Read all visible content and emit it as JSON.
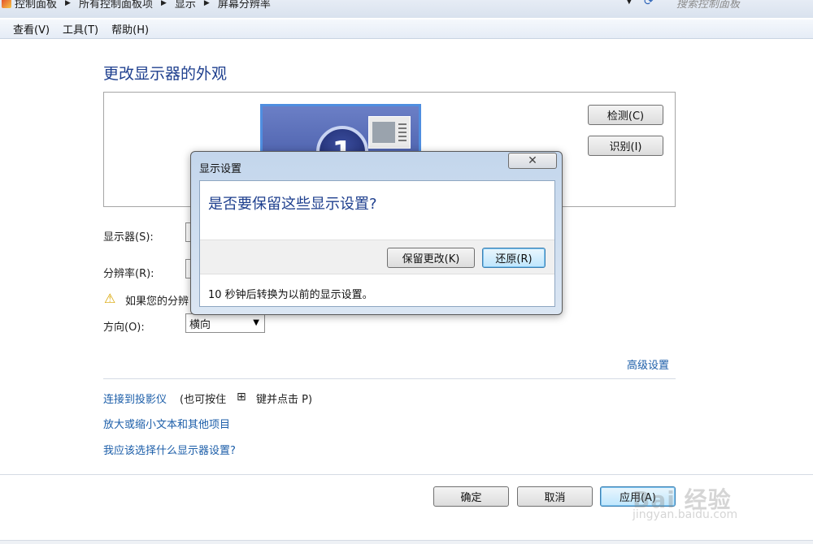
{
  "address_bar": {
    "crumbs": [
      "控制面板",
      "所有控制面板项",
      "显示",
      "屏幕分辨率"
    ],
    "search_placeholder": "搜索控制面板"
  },
  "menu": [
    "查看(V)",
    "工具(T)",
    "帮助(H)"
  ],
  "main": {
    "title": "更改显示器的外观",
    "monitor_number": "1",
    "detect_button": "检测(C)",
    "identify_button": "识别(I)",
    "display_label": "显示器(S):",
    "resolution_label": "分辨率(R):",
    "warning_text": "如果您的分辨",
    "orientation_label": "方向(O):",
    "orientation_value": "横向",
    "advanced_link": "高级设置",
    "projector_link": "连接到投影仪",
    "projector_hint_pre": "(也可按住",
    "projector_hint_post": "键并点击 P)",
    "text_size_link": "放大或缩小文本和其他项目",
    "which_settings_link": "我应该选择什么显示器设置?",
    "ok_button": "确定",
    "cancel_button": "取消",
    "apply_button": "应用(A)"
  },
  "dialog": {
    "title": "显示设置",
    "question": "是否要保留这些显示设置?",
    "keep_button": "保留更改(K)",
    "revert_button": "还原(R)",
    "countdown": "10 秒钟后转换为以前的显示设置。"
  },
  "watermark": {
    "text": "Bai 经验",
    "sub": "jingyan.baidu.com"
  },
  "colors": {
    "title_blue": "#1e3f8e",
    "link_blue": "#1c5ea9",
    "warning_yellow": "#d9a400"
  }
}
